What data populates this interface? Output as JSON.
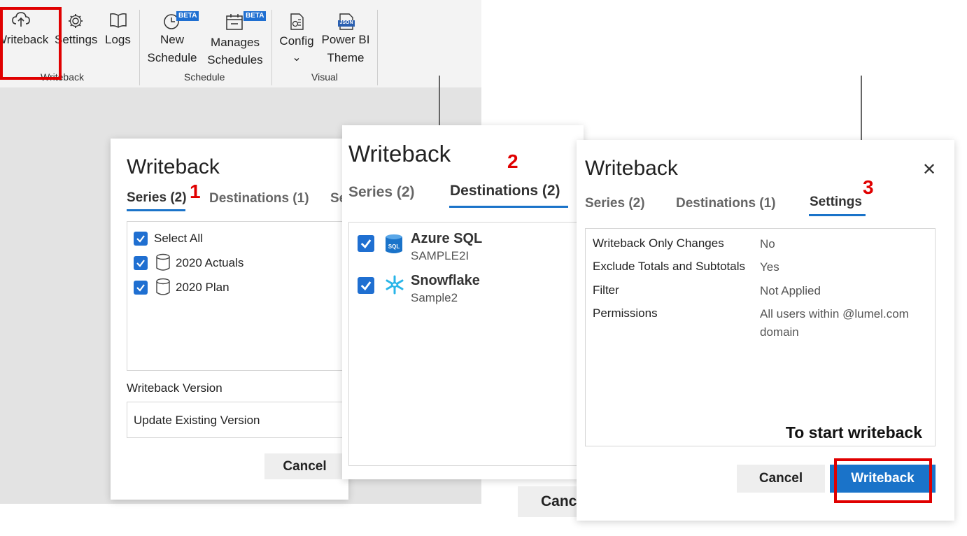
{
  "ribbon": {
    "buttons": {
      "writeback": "Writeback",
      "settings": "Settings",
      "logs": "Logs",
      "new_schedule_1": "New",
      "new_schedule_2": "Schedule",
      "manages_schedules_1": "Manages",
      "manages_schedules_2": "Schedules",
      "config": "Config",
      "config_chevron": "⌄",
      "power_bi_theme_1": "Power BI",
      "power_bi_theme_2": "Theme"
    },
    "badges": {
      "beta": "BETA",
      "json": "JSON"
    },
    "groups": {
      "writeback": "Writeback",
      "schedule": "Schedule",
      "visual": "Visual"
    }
  },
  "panel1": {
    "title": "Writeback",
    "step": "1",
    "tabs": [
      "Series (2)",
      "Destinations (1)",
      "Se"
    ],
    "series": {
      "select_all": "Select All",
      "items": [
        "2020 Actuals",
        "2020 Plan"
      ]
    },
    "version_label": "Writeback Version",
    "version_value": "Update Existing Version",
    "cancel": "Cancel"
  },
  "panel2": {
    "title": "Writeback",
    "step": "2",
    "tabs": [
      "Series (2)",
      "Destinations (2)"
    ],
    "destinations": [
      {
        "name": "Azure SQL",
        "sub": "SAMPLE2I",
        "icon": "azure-sql-icon",
        "icon_text": "SQL"
      },
      {
        "name": "Snowflake",
        "sub": "Sample2",
        "icon": "snowflake-icon"
      }
    ],
    "cancel": "Canc"
  },
  "panel3": {
    "title": "Writeback",
    "step": "3",
    "tabs": [
      "Series (2)",
      "Destinations (1)",
      "Settings"
    ],
    "settings": [
      {
        "label": "Writeback Only Changes",
        "value": "No"
      },
      {
        "label": "Exclude Totals and Subtotals",
        "value": "Yes"
      },
      {
        "label": "Filter",
        "value": "Not Applied"
      },
      {
        "label": "Permissions",
        "value": "All users within @lumel.com domain"
      }
    ],
    "annotation": "To start writeback",
    "cancel": "Cancel",
    "writeback": "Writeback",
    "close_glyph": "✕"
  },
  "colors": {
    "accent": "#1a73c9",
    "highlight": "#e00000"
  }
}
